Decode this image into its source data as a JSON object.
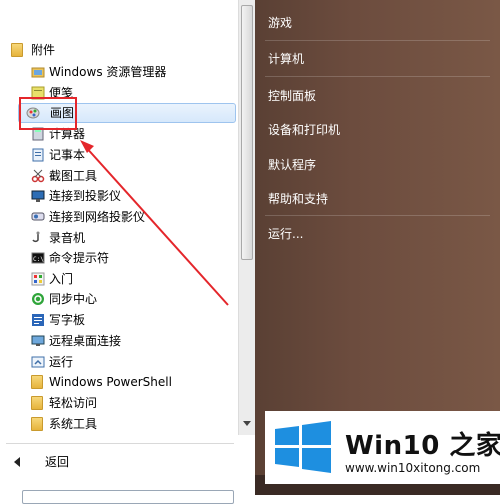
{
  "left_list": {
    "items": [
      {
        "label": "附件",
        "icon": "folder-icon"
      },
      {
        "label": "Windows 资源管理器",
        "icon": "explorer-icon"
      },
      {
        "label": "便笺",
        "icon": "sticky-notes-icon"
      },
      {
        "label": "画图",
        "icon": "paint-icon"
      },
      {
        "label": "计算器",
        "icon": "calculator-icon"
      },
      {
        "label": "记事本",
        "icon": "notepad-icon"
      },
      {
        "label": "截图工具",
        "icon": "snipping-tool-icon"
      },
      {
        "label": "连接到投影仪",
        "icon": "projector-icon"
      },
      {
        "label": "连接到网络投影仪",
        "icon": "network-projector-icon"
      },
      {
        "label": "录音机",
        "icon": "sound-recorder-icon"
      },
      {
        "label": "命令提示符",
        "icon": "command-prompt-icon"
      },
      {
        "label": "入门",
        "icon": "getting-started-icon"
      },
      {
        "label": "同步中心",
        "icon": "sync-center-icon"
      },
      {
        "label": "写字板",
        "icon": "wordpad-icon"
      },
      {
        "label": "远程桌面连接",
        "icon": "remote-desktop-icon"
      },
      {
        "label": "运行",
        "icon": "run-icon"
      },
      {
        "label": "Windows PowerShell",
        "icon": "folder-icon"
      },
      {
        "label": "轻松访问",
        "icon": "folder-icon"
      },
      {
        "label": "系统工具",
        "icon": "folder-icon"
      }
    ],
    "back_label": "返回"
  },
  "right_menu": {
    "items": [
      "游戏",
      "计算机",
      "控制面板",
      "设备和打印机",
      "默认程序",
      "帮助和支持",
      "运行..."
    ]
  },
  "watermark": {
    "title": "Win10 之家",
    "url": "www.win10xitong.com"
  },
  "colors": {
    "highlight": "#e4262b",
    "right_pane": "#6c4c3e",
    "win_logo": "#1e8fe0"
  }
}
